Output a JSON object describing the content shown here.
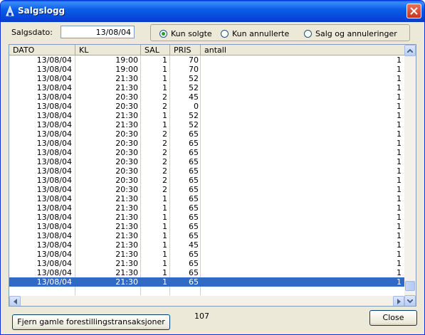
{
  "window": {
    "title": "Salgslogg"
  },
  "filter": {
    "date_label": "Salgsdato:",
    "date_value": "13/08/04",
    "options": [
      {
        "label": "Kun solgte",
        "selected": true
      },
      {
        "label": "Kun annullerte",
        "selected": false
      },
      {
        "label": "Salg og annuleringer",
        "selected": false
      }
    ]
  },
  "table": {
    "columns": [
      "DATO",
      "KL",
      "SAL",
      "PRIS",
      "antall"
    ],
    "rows": [
      [
        "13/08/04",
        "19:00",
        "1",
        "70",
        "1"
      ],
      [
        "13/08/04",
        "19:00",
        "1",
        "70",
        "1"
      ],
      [
        "13/08/04",
        "21:30",
        "1",
        "52",
        "1"
      ],
      [
        "13/08/04",
        "21:30",
        "1",
        "52",
        "1"
      ],
      [
        "13/08/04",
        "20:30",
        "2",
        "45",
        "1"
      ],
      [
        "13/08/04",
        "20:30",
        "2",
        "0",
        "1"
      ],
      [
        "13/08/04",
        "21:30",
        "1",
        "52",
        "1"
      ],
      [
        "13/08/04",
        "21:30",
        "1",
        "52",
        "1"
      ],
      [
        "13/08/04",
        "20:30",
        "2",
        "65",
        "1"
      ],
      [
        "13/08/04",
        "20:30",
        "2",
        "65",
        "1"
      ],
      [
        "13/08/04",
        "20:30",
        "2",
        "65",
        "1"
      ],
      [
        "13/08/04",
        "20:30",
        "2",
        "65",
        "1"
      ],
      [
        "13/08/04",
        "20:30",
        "2",
        "65",
        "1"
      ],
      [
        "13/08/04",
        "20:30",
        "2",
        "65",
        "1"
      ],
      [
        "13/08/04",
        "20:30",
        "2",
        "65",
        "1"
      ],
      [
        "13/08/04",
        "21:30",
        "1",
        "65",
        "1"
      ],
      [
        "13/08/04",
        "21:30",
        "1",
        "65",
        "1"
      ],
      [
        "13/08/04",
        "21:30",
        "1",
        "65",
        "1"
      ],
      [
        "13/08/04",
        "21:30",
        "1",
        "65",
        "1"
      ],
      [
        "13/08/04",
        "21:30",
        "1",
        "65",
        "1"
      ],
      [
        "13/08/04",
        "21:30",
        "1",
        "45",
        "1"
      ],
      [
        "13/08/04",
        "21:30",
        "1",
        "65",
        "1"
      ],
      [
        "13/08/04",
        "21:30",
        "1",
        "65",
        "1"
      ],
      [
        "13/08/04",
        "21:30",
        "1",
        "65",
        "1"
      ],
      [
        "13/08/04",
        "21:30",
        "1",
        "65",
        "1"
      ]
    ],
    "selected_row": 24
  },
  "footer": {
    "purge_button": "Fjern gamle forestillingstransaksjoner",
    "count": "107",
    "close_button": "Close"
  },
  "colors": {
    "selection": "#316ac5",
    "titlebar": "#0a5fe8"
  }
}
